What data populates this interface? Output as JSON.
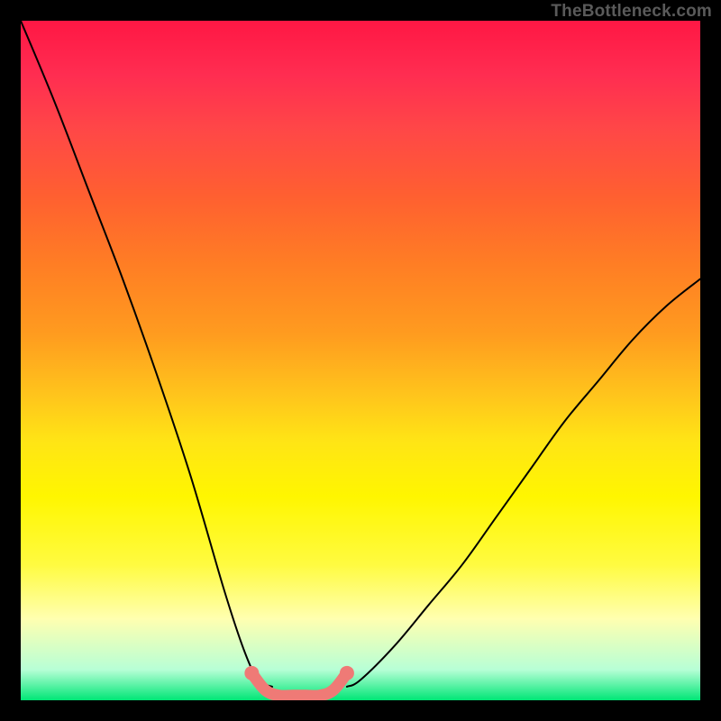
{
  "watermark": "TheBottleneck.com",
  "chart_data": {
    "type": "line",
    "title": "",
    "xlabel": "",
    "ylabel": "",
    "xlim": [
      0,
      100
    ],
    "ylim": [
      0,
      100
    ],
    "series": [
      {
        "name": "left-curve",
        "x": [
          0,
          5,
          10,
          15,
          20,
          25,
          30,
          33,
          35,
          37
        ],
        "values": [
          100,
          88,
          75,
          62,
          48,
          33,
          16,
          7,
          3,
          2
        ]
      },
      {
        "name": "right-curve",
        "x": [
          48,
          50,
          55,
          60,
          65,
          70,
          75,
          80,
          85,
          90,
          95,
          100
        ],
        "values": [
          2,
          3,
          8,
          14,
          20,
          27,
          34,
          41,
          47,
          53,
          58,
          62
        ]
      },
      {
        "name": "trough-highlight",
        "x": [
          34,
          36,
          38,
          40,
          42,
          44,
          46,
          48
        ],
        "values": [
          4,
          1.5,
          0.7,
          0.7,
          0.7,
          0.7,
          1.5,
          4
        ]
      }
    ],
    "colors": {
      "curve": "#000000",
      "trough": "#ef7a76",
      "gradient_top": "#ff1744",
      "gradient_mid": "#fff600",
      "gradient_bottom": "#00e676"
    }
  }
}
